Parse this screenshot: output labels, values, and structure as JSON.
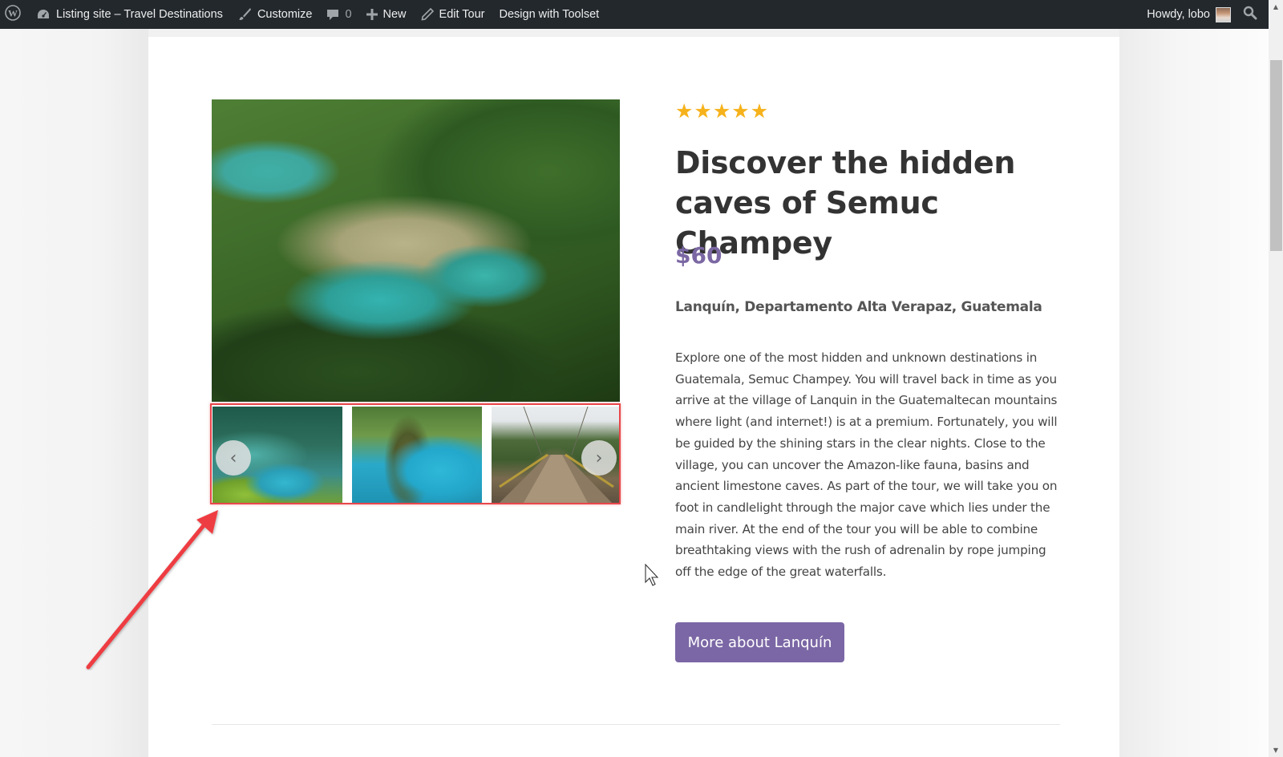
{
  "adminbar": {
    "site_name": "Listing site – Travel Destinations",
    "customize": "Customize",
    "comments_count": "0",
    "new": "New",
    "edit": "Edit Tour",
    "design": "Design with Toolset",
    "greeting": "Howdy, lobo"
  },
  "icons": {
    "wp": "wordpress-logo-icon",
    "dashboard": "dashboard-icon",
    "customize": "paintbrush-icon",
    "comments": "comment-bubble-icon",
    "new": "plus-icon",
    "edit": "pencil-icon",
    "search": "search-icon",
    "prev": "‹",
    "next": "›",
    "star": "★"
  },
  "tour": {
    "rating": 5,
    "rating_max": 5,
    "title": "Discover the hidden caves of Semuc Champey",
    "price": "$60",
    "location": "Lanquín, Departamento Alta Verapaz, Guatemala",
    "description": "Explore one of the most hidden and unknown destinations in Guatemala, Semuc Champey. You will travel back in time as you arrive at the village of Lanquin in the Guatemaltecan mountains where light (and internet!) is at a premium. Fortunately, you will be guided by the shining stars in the clear nights. Close to the village, you can uncover the Amazon-like fauna, basins and ancient limestone caves. As part of the tour, we will take you on foot in candlelight through the major cave which lies under the main river. At the end of the tour you will be able to combine breathtaking views with the rush of adrenalin by rope jumping off the edge of the great waterfalls.",
    "button_label": "More about Lanquín"
  },
  "gallery": {
    "main_image": "Aerial view of turquoise pools of Semuc Champey in jungle",
    "thumbnails": [
      "Turquoise terraced pools",
      "Tree over blue river",
      "Wooden suspension bridge"
    ]
  },
  "colors": {
    "accent": "#7b67a5",
    "price": "#7a67a3",
    "star": "#f6b21c",
    "highlight": "#e8474b",
    "adminbar": "#23282d"
  }
}
